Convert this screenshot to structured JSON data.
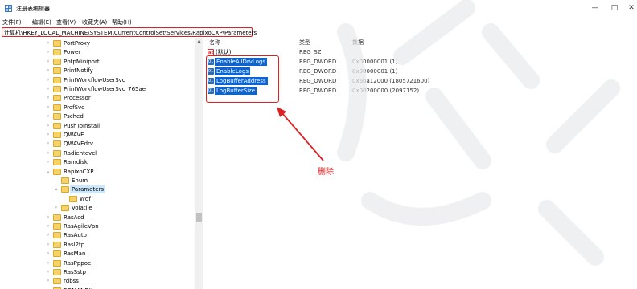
{
  "window": {
    "title": "注册表编辑器",
    "minimize_glyph": "—",
    "maximize_glyph": "□",
    "close_glyph": "✕"
  },
  "menu": {
    "items": [
      "文件(F)",
      "编辑(E)",
      "查看(V)",
      "收藏夹(A)",
      "帮助(H)"
    ]
  },
  "address": {
    "path": "计算机\\HKEY_LOCAL_MACHINE\\SYSTEM\\CurrentControlSet\\Services\\RapixoCXP\\Parameters"
  },
  "tree": {
    "items": [
      {
        "label": "PortProxy",
        "chevron": "›"
      },
      {
        "label": "Power",
        "chevron": "›"
      },
      {
        "label": "PptpMiniport",
        "chevron": "›"
      },
      {
        "label": "PrintNotify",
        "chevron": "›"
      },
      {
        "label": "PrintWorkflowUserSvc",
        "chevron": "›"
      },
      {
        "label": "PrintWorkflowUserSvc_765ae",
        "chevron": "›"
      },
      {
        "label": "Processor",
        "chevron": "›"
      },
      {
        "label": "ProfSvc",
        "chevron": "›"
      },
      {
        "label": "Psched",
        "chevron": "›"
      },
      {
        "label": "PushToInstall",
        "chevron": "›"
      },
      {
        "label": "QWAVE",
        "chevron": "›"
      },
      {
        "label": "QWAVEdrv",
        "chevron": "›"
      },
      {
        "label": "Radientevcl",
        "chevron": "›"
      },
      {
        "label": "Ramdisk",
        "chevron": "›"
      },
      {
        "label": "RapixoCXP",
        "chevron": "⌄"
      },
      {
        "label": "Enum",
        "chevron": ""
      },
      {
        "label": "Parameters",
        "chevron": "⌄"
      },
      {
        "label": "Wdf",
        "chevron": ""
      },
      {
        "label": "Volatile",
        "chevron": "›"
      },
      {
        "label": "RasAcd",
        "chevron": "›"
      },
      {
        "label": "RasAgileVpn",
        "chevron": "›"
      },
      {
        "label": "RasAuto",
        "chevron": "›"
      },
      {
        "label": "Rasl2tp",
        "chevron": "›"
      },
      {
        "label": "RasMan",
        "chevron": "›"
      },
      {
        "label": "RasPppoe",
        "chevron": "›"
      },
      {
        "label": "RasSstp",
        "chevron": "›"
      },
      {
        "label": "rdbss",
        "chevron": "›"
      },
      {
        "label": "RDMANDK",
        "chevron": "›"
      }
    ],
    "selected_index": 16,
    "folder_color": "#f6d36a"
  },
  "values_pane": {
    "headers": {
      "name": "名称",
      "type": "类型",
      "data": "数据"
    },
    "rows": [
      {
        "icon": "ab",
        "name": "(默认)",
        "type": "REG_SZ",
        "data": ""
      },
      {
        "icon": "bin",
        "name": "EnableAllDrvLogs",
        "type": "REG_DWORD",
        "data": "0x00000001 (1)"
      },
      {
        "icon": "bin",
        "name": "EnableLogs",
        "type": "REG_DWORD",
        "data": "0x00000001 (1)"
      },
      {
        "icon": "bin",
        "name": "LogBufferAddress",
        "type": "REG_QWORD",
        "data": "0x6ba12000 (1805721600)"
      },
      {
        "icon": "bin",
        "name": "LogBufferSize",
        "type": "REG_DWORD",
        "data": "0x00200000 (2097152)"
      }
    ]
  },
  "annotation": {
    "label": "删除",
    "color": "#e02020"
  },
  "colors": {
    "selection_blue": "#0a64d6",
    "tree_selection": "#cce8ff"
  }
}
